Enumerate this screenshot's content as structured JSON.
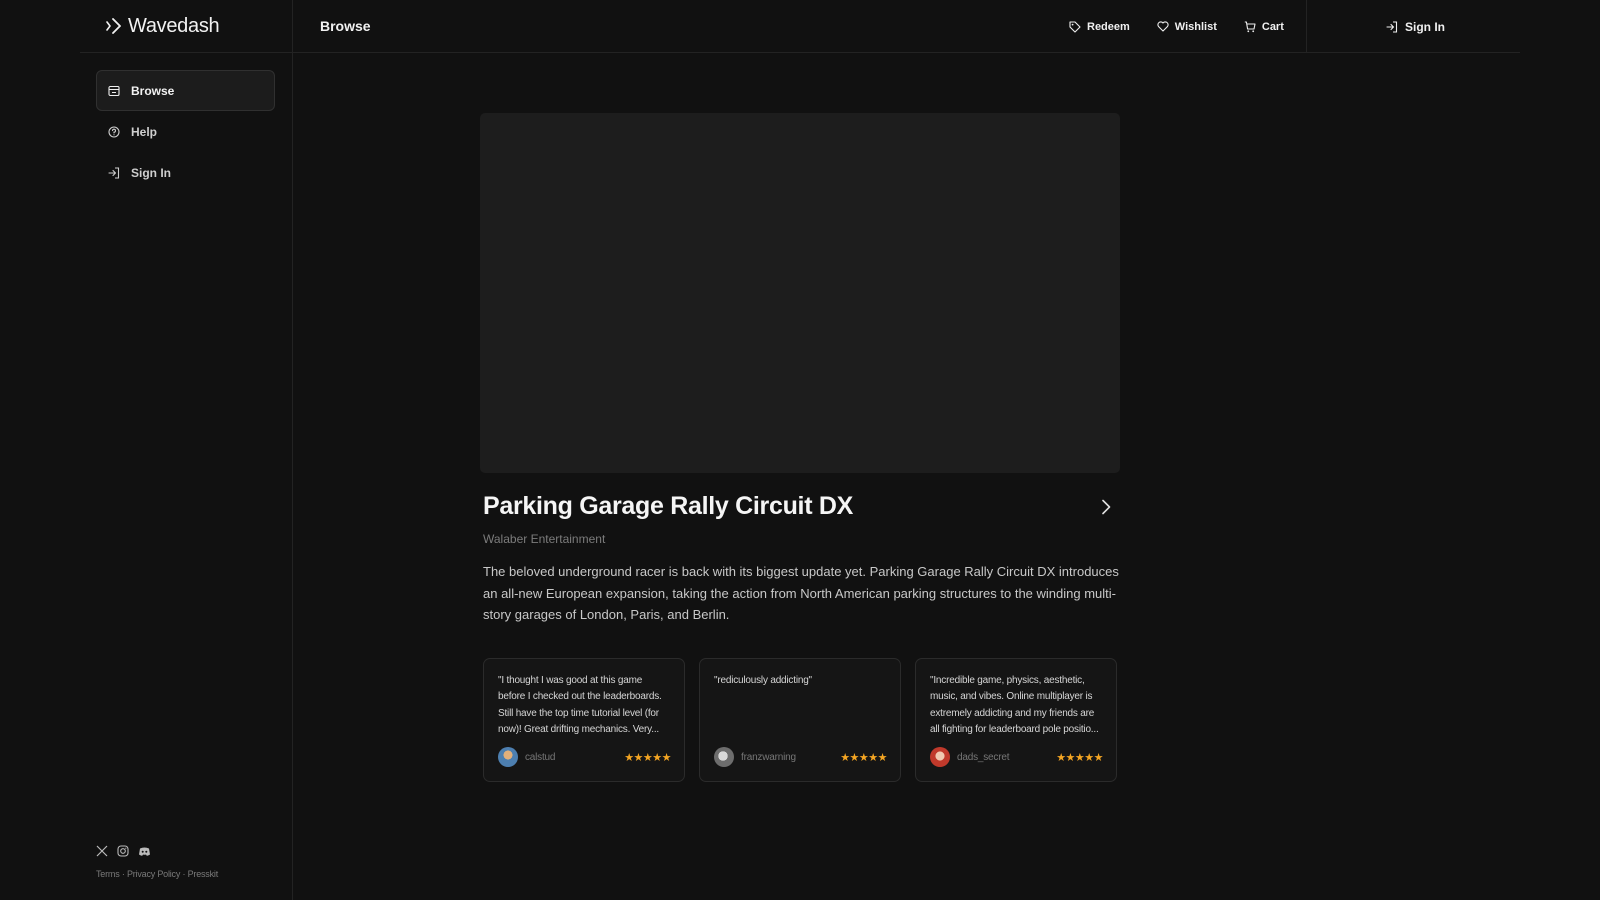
{
  "brand": {
    "name": "Wavedash"
  },
  "header": {
    "title": "Browse",
    "nav": [
      {
        "label": "Redeem",
        "icon": "tag-icon"
      },
      {
        "label": "Wishlist",
        "icon": "heart-icon"
      },
      {
        "label": "Cart",
        "icon": "cart-icon"
      }
    ],
    "sign_in": "Sign In"
  },
  "sidebar": {
    "items": [
      {
        "label": "Browse",
        "icon": "store-icon",
        "active": true
      },
      {
        "label": "Help",
        "icon": "help-circle-icon",
        "active": false
      },
      {
        "label": "Sign In",
        "icon": "sign-in-icon",
        "active": false
      }
    ],
    "social": [
      "x-icon",
      "instagram-icon",
      "discord-icon"
    ],
    "legal": {
      "terms": "Terms",
      "privacy": "Privacy Policy",
      "presskit": "Presskit",
      "separator": "·"
    }
  },
  "game": {
    "title": "Parking Garage Rally Circuit DX",
    "publisher": "Walaber Entertainment",
    "description": "The beloved underground racer is back with its biggest update yet. Parking Garage Rally Circuit DX introduces an all-new European expansion, taking the action from North American parking structures to the winding multi-story garages of London, Paris, and Berlin."
  },
  "reviews": [
    {
      "text": "\"I thought I was good at this game before I checked out the leaderboards. Still have the top time tutorial level (for now)! Great drifting mechanics. Very...",
      "author": "calstud",
      "stars": "★★★★★",
      "rating": 5
    },
    {
      "text": "\"rediculously addicting\"",
      "author": "franzwarning",
      "stars": "★★★★★",
      "rating": 5
    },
    {
      "text": "\"Incredible game, physics, aesthetic, music, and vibes. Online multiplayer is extremely addicting and my friends are all fighting for leaderboard pole positio...",
      "author": "dads_secret",
      "stars": "★★★★★",
      "rating": 5
    }
  ],
  "colors": {
    "background": "#111111",
    "card": "#1d1d1d",
    "star": "#f5a623",
    "muted": "#7c7c7c"
  }
}
